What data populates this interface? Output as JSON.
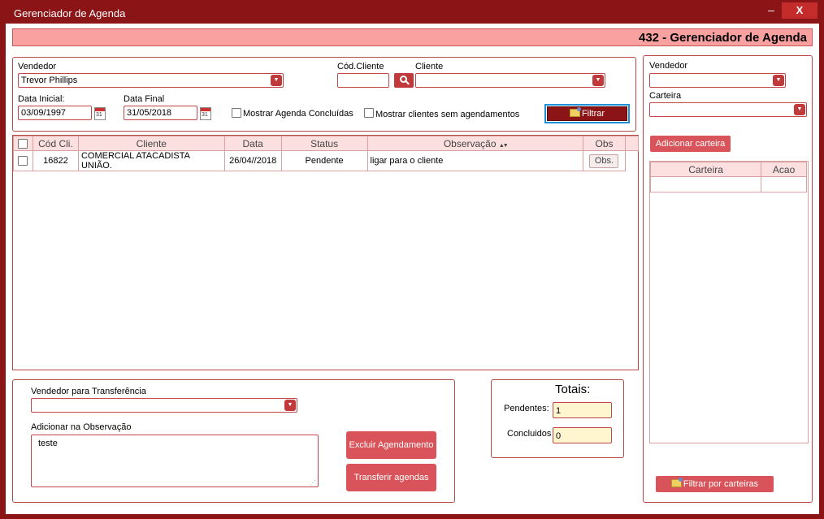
{
  "window": {
    "title": "Gerenciador de Agenda",
    "minimize_glyph": "–",
    "close_glyph": "X"
  },
  "header": {
    "title": "432 - Gerenciador de Agenda"
  },
  "filters": {
    "vendedor_label": "Vendedor",
    "vendedor_value": "Trevor Phillips",
    "cod_cliente_label": "Cód.Cliente",
    "cod_cliente_value": "",
    "cliente_label": "Cliente",
    "cliente_value": "",
    "data_inicial_label": "Data Inicial:",
    "data_inicial_value": "03/09/1997",
    "data_final_label": "Data Final",
    "data_final_value": "31/05/2018",
    "calendar_day": "31",
    "mostrar_concluidas_label": "Mostrar Agenda Concluídas",
    "mostrar_sem_agend_label": "Mostrar clientes sem agendamentos",
    "filtrar_label": "Filtrar"
  },
  "table": {
    "headers": [
      "Cód Cli.",
      "Cliente",
      "Data",
      "Status",
      "Observação",
      "Obs"
    ],
    "sort_glyph": "▲▼",
    "rows": [
      {
        "cod": "16822",
        "cliente": "COMERCIAL ATACADISTA UNIÃO.",
        "data": "26/04//2018",
        "status": "Pendente",
        "observacao": "ligar para o cliente",
        "obs_button": "Obs."
      }
    ]
  },
  "transfer": {
    "vendedor_label": "Vendedor para Transferência",
    "vendedor_value": "",
    "observacao_label": "Adicionar na Observação",
    "observacao_value": "teste",
    "excluir_label": "Excluir Agendamento",
    "transferir_label": "Transferir agendas"
  },
  "totais": {
    "title": "Totais:",
    "pendentes_label": "Pendentes:",
    "pendentes_value": "1",
    "concluidos_label": "Concluidos",
    "concluidos_value": "0"
  },
  "right_panel": {
    "vendedor_label": "Vendedor",
    "vendedor_value": "",
    "carteira_label": "Carteira",
    "carteira_value": "",
    "add_carteira_label": "Adicionar carteira",
    "table_headers": [
      "Carteira",
      "Acao"
    ],
    "filtrar_carteiras_label": "Filtrar por carteiras"
  },
  "colors": {
    "window_frame": "#8b1416",
    "header_bar": "#f9a0a0",
    "accent_red": "#c0393b",
    "button_red": "#d9545a",
    "filtrar_focus_border": "#1e90d8"
  },
  "icons": [
    "minimize-icon",
    "close-icon",
    "search-icon",
    "calendar-icon",
    "dropdown-arrow-icon",
    "folder-icon",
    "sort-icon",
    "resize-grip-icon"
  ]
}
